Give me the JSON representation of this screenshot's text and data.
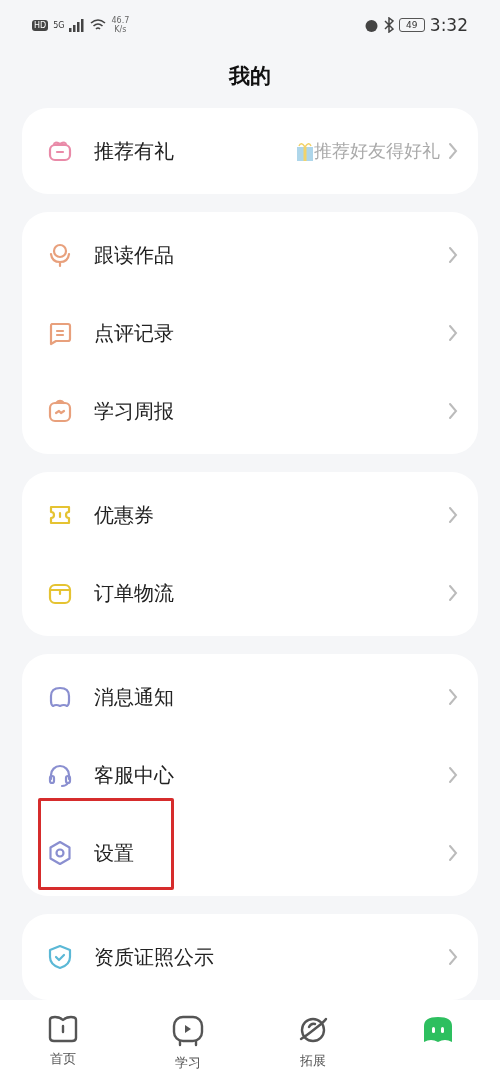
{
  "status_bar": {
    "hd": "HD",
    "network": "5G",
    "speed_value": "46.7",
    "speed_unit": "K/s",
    "battery": "49",
    "time": "3:32"
  },
  "title": "我的",
  "groups": [
    {
      "items": [
        {
          "kind": "gift",
          "label": "推荐有礼",
          "color": "#e98aa8",
          "hint": "推荐好友得好礼",
          "highlighted": false
        }
      ]
    },
    {
      "items": [
        {
          "kind": "mic",
          "label": "跟读作品",
          "color": "#e8a07c",
          "highlighted": false
        },
        {
          "kind": "comment",
          "label": "点评记录",
          "color": "#e8a07c",
          "highlighted": false
        },
        {
          "kind": "report",
          "label": "学习周报",
          "color": "#e8a07c",
          "highlighted": false
        }
      ]
    },
    {
      "items": [
        {
          "kind": "coupon",
          "label": "优惠券",
          "color": "#e5c332",
          "highlighted": false
        },
        {
          "kind": "box",
          "label": "订单物流",
          "color": "#e5c332",
          "highlighted": false
        }
      ]
    },
    {
      "items": [
        {
          "kind": "bell",
          "label": "消息通知",
          "color": "#8a8fd0",
          "highlighted": false
        },
        {
          "kind": "headset",
          "label": "客服中心",
          "color": "#8a8fd0",
          "highlighted": false
        },
        {
          "kind": "gear",
          "label": "设置",
          "color": "#8a8fd0",
          "highlighted": true
        }
      ]
    },
    {
      "items": [
        {
          "kind": "shield",
          "label": "资质证照公示",
          "color": "#5bb8d6",
          "highlighted": false
        }
      ]
    }
  ],
  "tabs": [
    {
      "kind": "book",
      "label": "首页",
      "selected": false
    },
    {
      "kind": "tv",
      "label": "学习",
      "selected": false
    },
    {
      "kind": "planet",
      "label": "拓展",
      "selected": false
    },
    {
      "kind": "me",
      "selected": true
    }
  ]
}
